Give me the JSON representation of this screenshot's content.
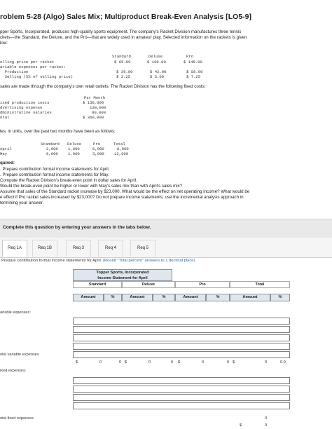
{
  "title": "roblem 5-28 (Algo) Sales Mix; Multiproduct Break-Even Analysis [LO5-9]",
  "intro": [
    "pper Sports, Incorporated, produces high-quality sports equipment. The company's Racket Division manufactures three tennis",
    "ckets—the Standard, the Deluxe, and the Pro—that are widely used in amateur play. Selected information on the rackets is given",
    "low:"
  ],
  "product_table": {
    "rows": [
      [
        "",
        "Standard",
        "Deluxe",
        "Pro"
      ],
      [
        "elling price per racket",
        "$ 65.00",
        "$ 100.00",
        "$ 145.00"
      ],
      [
        "ariable expenses per racket:",
        "",
        "",
        ""
      ],
      [
        "  Production",
        "$ 39.00",
        "$ 42.00",
        "$ 58.00"
      ],
      [
        "  Selling (5% of selling price)",
        "$ 3.25",
        "$ 5.00",
        "$ 7.25"
      ]
    ]
  },
  "sales_text": " sales are made through the company's own retail outlets. The Racket Division has the following fixed costs:",
  "fixed_costs": {
    "header": "Per Month",
    "rows": [
      [
        "ixed production costs",
        "$ 150,000"
      ],
      [
        "dvertising expense",
        "130,000"
      ],
      [
        "dministrative salaries",
        "80,000"
      ],
      [
        "otal",
        "$ 360,000"
      ]
    ]
  },
  "units_text": "les, in units, over the past two months have been as follows:",
  "units_table": {
    "header": [
      "",
      "Standard",
      "Deluxe",
      "Pro",
      "Total"
    ],
    "rows": [
      [
        "April",
        "2,000",
        "1,000",
        "5,000",
        "8,000"
      ],
      [
        "May",
        "8,000",
        "1,000",
        "3,000",
        "12,000"
      ]
    ]
  },
  "required": [
    "quired:",
    ". Prepare contribution format income statements for April.",
    ". Prepare contribution format income statements for May.",
    "Compute the Racket Division's break-even point in dollar sales for April.",
    "Would the break-even point be higher or lower with May's sales mix than with April's sales mix?",
    "Assume that sales of the Standard racket increase by $23,000. What would be the effect on net operating income? What would be",
    "e effect if Pro racket sales increased by $23,000? Do not prepare income statements; use the incremental analysis approach in",
    "termining your answer."
  ],
  "info_bar": "Complete this question by entering your answers in the tabs below.",
  "tabs": [
    "Req 1A",
    "Req 1B",
    "Req 3",
    "Req 4",
    "Req 5"
  ],
  "instruction": "Prepare contribution format income statements for April.",
  "instruction_hint": "(Round \"Total percent\" answers to 1 decimal place)",
  "statement": {
    "company": "Topper Sports, Incorporated",
    "name": "Income Statement for April",
    "groups": [
      "Standard",
      "Deluxe",
      "Pro",
      "Total"
    ],
    "subheads": [
      "Amount",
      "%",
      "Amount",
      "%",
      "Amount",
      "%",
      "Amount",
      "%"
    ],
    "labels": {
      "variable": "ariable expenses:",
      "total_variable": "otal variable expenses",
      "fixed": "ixed expenses:",
      "total_fixed": "otal fixed expenses"
    },
    "values": {
      "dollar": "$",
      "zero": "0",
      "zero_pct": "0.0"
    }
  }
}
